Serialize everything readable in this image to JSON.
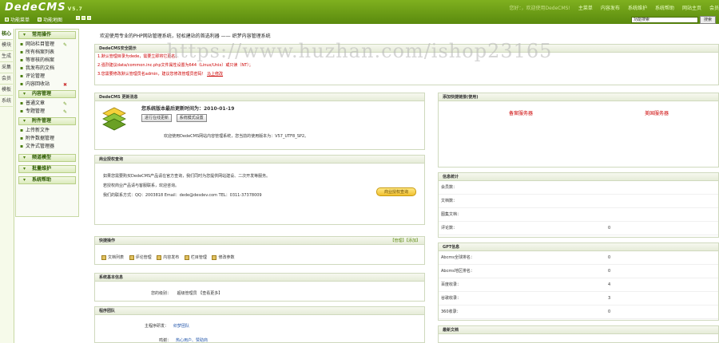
{
  "header": {
    "logo": "DedeCMS",
    "version": "V5.7",
    "sublinks": [
      "功能菜单",
      "功能地图"
    ],
    "nav": [
      "您好：，欢迎使用DedeCMS!",
      "主菜单",
      "内容发布",
      "系统维护",
      "系统帮助",
      "网站主页",
      "会员"
    ],
    "search_value": "功能搜索",
    "search_button": "搜索"
  },
  "left_tabs": [
    "核心",
    "模块",
    "生成",
    "采集",
    "会员",
    "模板",
    "系统"
  ],
  "menu": {
    "sections": [
      {
        "title": "常用操作",
        "items": [
          "网站栏目管理",
          "所有档案列表",
          "等审核的档案",
          "我发布的文档",
          "评论管理",
          "内容回收站"
        ]
      },
      {
        "title": "内容管理",
        "items": [
          "普通文章",
          "专题管理"
        ]
      },
      {
        "title": "附件管理",
        "items": [
          "上传新文件",
          "附件数据管理",
          "文件式管理器"
        ]
      },
      {
        "title": "频道模型",
        "items": []
      },
      {
        "title": "批量维护",
        "items": []
      },
      {
        "title": "系统帮助",
        "items": []
      }
    ]
  },
  "welcome": "欢迎使用专业的PHP网站管理系统，轻松建站的首选利器 —— 织梦内容管理系统",
  "security": {
    "title": "DedeCMS安全提示",
    "lines": [
      "1.默认管理目录为dede，需要立即将它更名；",
      "2.强烈建议data/common.inc.php文件属性设置为644（Linux/Unix）或只读（NT）；",
      "3.您需要修改默认管理员名admin，建议您修改管理员密码！"
    ],
    "link": "马上修改"
  },
  "update": {
    "title": "DedeCMS 更新消息",
    "date_label": "您系统版本最后更新时间为：2010-01-19",
    "btn_update": "进行在线更新",
    "btn_mode": "系统模式设置",
    "msg": "欢迎使用DedeCMS网站内容管理系统，您当前的使用版本为：V57_UTF8_SP2。"
  },
  "commercial": {
    "title": "商业授权查询",
    "text1": "如果您需要购买DedeCMS产品请在官方查询，我们同时为您提供网站建设、二次开发等服务。",
    "text2": "若授权商业产品请与客服联系，欢迎咨询。",
    "text3": "我们的联系方式：QQ：2003818  Email：dede@desdev.com  TEL：0311-37378009",
    "btn": "商业授权查询"
  },
  "quick": {
    "title": "快捷操作",
    "right": "【管理】【添加】",
    "items": [
      "文档列表",
      "评论管理",
      "内容发布",
      "栏目管理",
      "修改参数"
    ]
  },
  "basic": {
    "title": "系统基本信息",
    "label": "您的级别：",
    "value": "超级管理员 【查看更多】"
  },
  "team": {
    "title": "程序团队",
    "rows": [
      {
        "label": "主程序研发：",
        "value": "织梦团队"
      },
      {
        "label": "鸣谢：",
        "value": "热心用户、赞助商"
      }
    ]
  },
  "ad": {
    "title": "添加快捷链接(使用)",
    "col1": "备案服务器",
    "col2": "美国服务器"
  },
  "stats": {
    "title": "信息统计",
    "rows": [
      {
        "label": "会员数：",
        "value": ""
      },
      {
        "label": "文档数：",
        "value": ""
      },
      {
        "label": "图集文档：",
        "value": ""
      },
      {
        "label": "评论数：",
        "value": "0"
      }
    ]
  },
  "gpl": {
    "title": "GPT信息",
    "rows": [
      {
        "label": "Abcms全球排名：",
        "value": "0"
      },
      {
        "label": "Abcms地区排名：",
        "value": "0"
      },
      {
        "label": "百度收录：",
        "value": "4"
      },
      {
        "label": "谷歌收录：",
        "value": "3"
      },
      {
        "label": "360收录：",
        "value": "0"
      }
    ]
  },
  "news": {
    "title": "最新文档"
  },
  "watermark": "https://www.huzhan.com/ishop23165"
}
